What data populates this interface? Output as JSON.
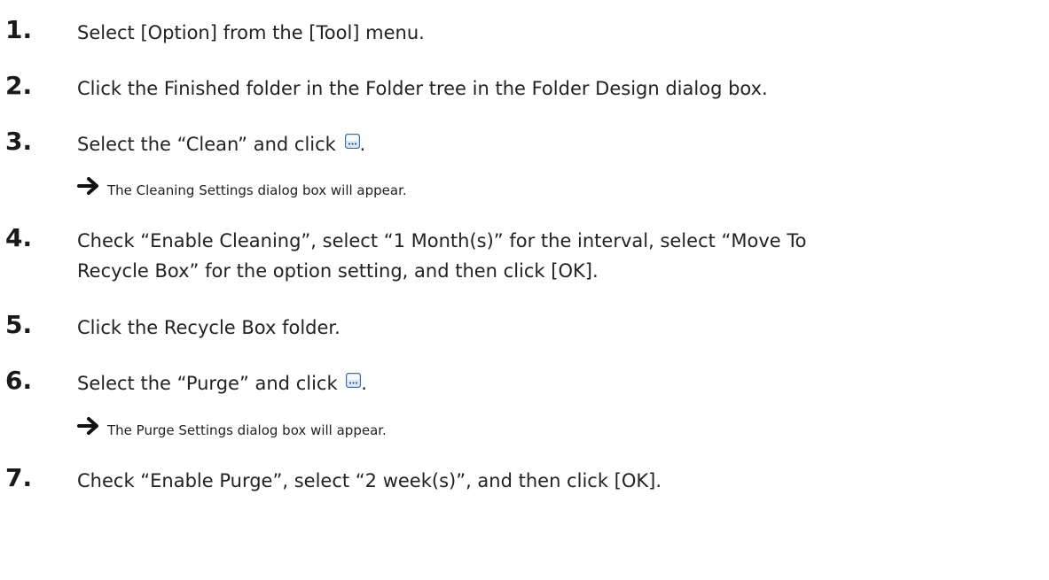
{
  "steps": [
    {
      "number": "1.",
      "text": "Select [Option] from the [Tool] menu."
    },
    {
      "number": "2.",
      "text": "Click the Finished folder in the Folder tree in the Folder Design dialog box."
    },
    {
      "number": "3.",
      "text_before_icon": "Select the “Clean” and click ",
      "text_after_icon": ".",
      "icon": "ellipsis-button-icon",
      "result": "The Cleaning Settings dialog box will appear."
    },
    {
      "number": "4.",
      "text_line1": "Check “Enable Cleaning”, select “1 Month(s)” for the interval, select “Move To",
      "text_line2": "Recycle Box” for the option setting, and then click [OK]."
    },
    {
      "number": "5.",
      "text": "Click the Recycle Box folder."
    },
    {
      "number": "6.",
      "text_before_icon": "Select the “Purge” and click ",
      "text_after_icon": ".",
      "icon": "ellipsis-button-icon",
      "result": "The Purge Settings dialog box will appear."
    },
    {
      "number": "7.",
      "text": "Check “Enable Purge”, select “2 week(s)”, and then click [OK]."
    }
  ],
  "colors": {
    "text": "#222222",
    "icon_border": "#3a6ea5",
    "icon_fill": "#dbe8f5"
  }
}
